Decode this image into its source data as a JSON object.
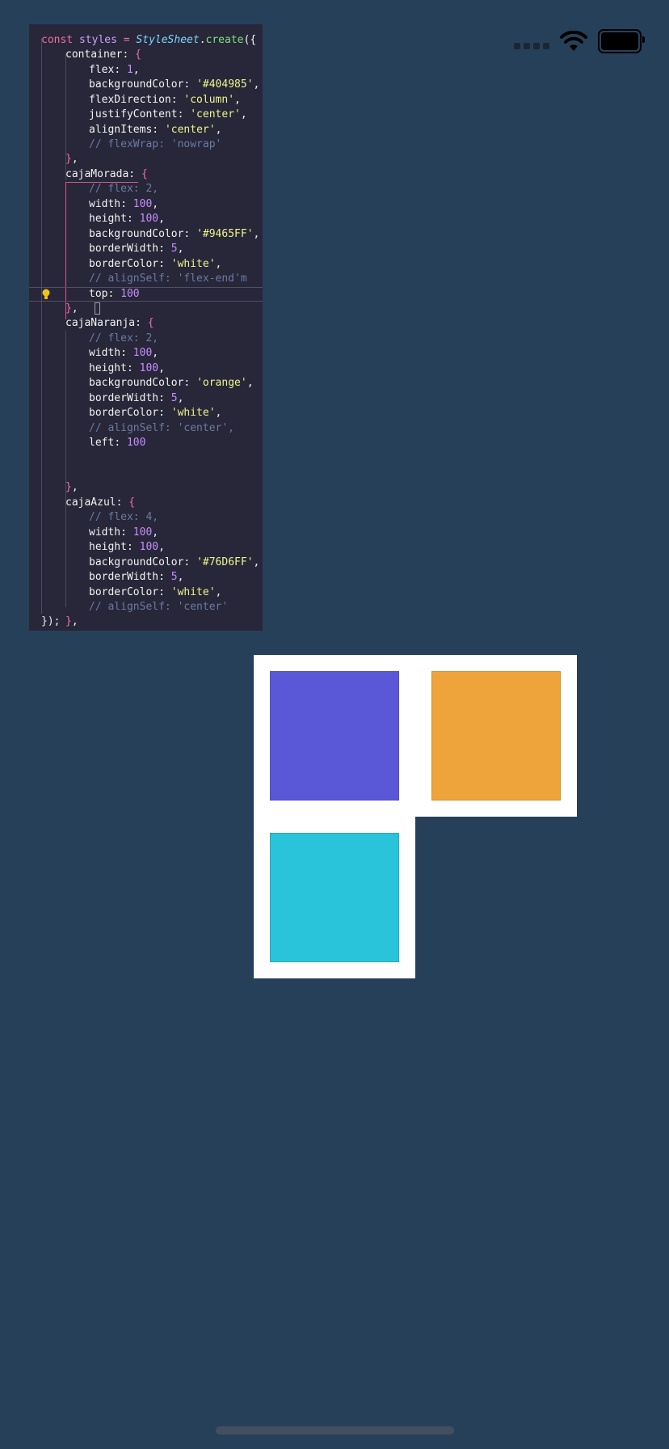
{
  "colors": {
    "background": "#27405a",
    "caja_morada": "#5b58d8",
    "caja_naranja": "#efa43b",
    "caja_azul": "#29c4da"
  },
  "status_bar": {
    "icons": [
      "signal-icon",
      "wifi-icon",
      "battery-icon"
    ]
  },
  "code": {
    "line1": "const styles = StyleSheet.create({",
    "container_key": "container",
    "flex_val": "1",
    "bg_val": "'#404985'",
    "flexdir_val": "'column'",
    "justify_val": "'center'",
    "align_val": "'center'",
    "comment_wrap": "// flexWrap: 'nowrap'",
    "morada_key": "cajaMorada",
    "comment_flex2": "// flex: 2,",
    "width_val": "100",
    "height_val": "100",
    "morada_bg": "'#9465FF'",
    "border_width_val": "5",
    "border_color_val": "'white'",
    "comment_align_end": "// alignSelf: 'flex-end'm",
    "top_val": "100",
    "naranja_key": "cajaNaranja",
    "naranja_bg": "'orange'",
    "comment_align_center_comma": "// alignSelf: 'center',",
    "left_val": "100",
    "azul_key": "cajaAzul",
    "comment_flex4": "// flex: 4,",
    "azul_bg": "'#76D6FF'",
    "comment_align_center": "// alignSelf: 'center'",
    "close": "});"
  }
}
